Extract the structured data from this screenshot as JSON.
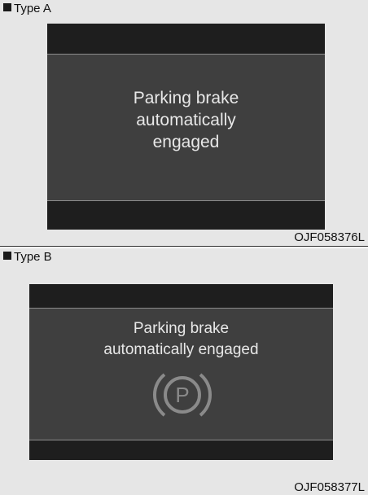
{
  "type_a": {
    "label": "Type A",
    "message_line1": "Parking brake",
    "message_line2": "automatically",
    "message_line3": "engaged",
    "code": "OJF058376L"
  },
  "type_b": {
    "label": "Type B",
    "message_line1": "Parking brake",
    "message_line2": "automatically engaged",
    "icon": "parking-brake-icon",
    "icon_letter": "P",
    "code": "OJF058377L"
  },
  "colors": {
    "page_background": "#e6e6e6",
    "screen_background": "#3f3f3f",
    "screen_bar": "#1e1e1e",
    "message_text": "#e8e8e8",
    "icon_color": "#8a8a8a"
  }
}
